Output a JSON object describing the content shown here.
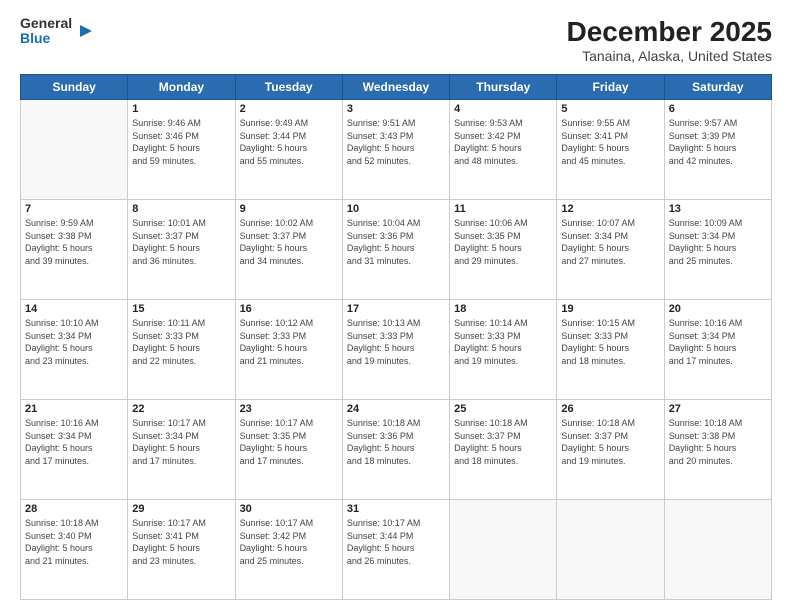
{
  "logo": {
    "line1": "General",
    "line2": "Blue"
  },
  "title": "December 2025",
  "subtitle": "Tanaina, Alaska, United States",
  "days_of_week": [
    "Sunday",
    "Monday",
    "Tuesday",
    "Wednesday",
    "Thursday",
    "Friday",
    "Saturday"
  ],
  "weeks": [
    [
      {
        "day": "",
        "info": ""
      },
      {
        "day": "1",
        "info": "Sunrise: 9:46 AM\nSunset: 3:46 PM\nDaylight: 5 hours\nand 59 minutes."
      },
      {
        "day": "2",
        "info": "Sunrise: 9:49 AM\nSunset: 3:44 PM\nDaylight: 5 hours\nand 55 minutes."
      },
      {
        "day": "3",
        "info": "Sunrise: 9:51 AM\nSunset: 3:43 PM\nDaylight: 5 hours\nand 52 minutes."
      },
      {
        "day": "4",
        "info": "Sunrise: 9:53 AM\nSunset: 3:42 PM\nDaylight: 5 hours\nand 48 minutes."
      },
      {
        "day": "5",
        "info": "Sunrise: 9:55 AM\nSunset: 3:41 PM\nDaylight: 5 hours\nand 45 minutes."
      },
      {
        "day": "6",
        "info": "Sunrise: 9:57 AM\nSunset: 3:39 PM\nDaylight: 5 hours\nand 42 minutes."
      }
    ],
    [
      {
        "day": "7",
        "info": "Sunrise: 9:59 AM\nSunset: 3:38 PM\nDaylight: 5 hours\nand 39 minutes."
      },
      {
        "day": "8",
        "info": "Sunrise: 10:01 AM\nSunset: 3:37 PM\nDaylight: 5 hours\nand 36 minutes."
      },
      {
        "day": "9",
        "info": "Sunrise: 10:02 AM\nSunset: 3:37 PM\nDaylight: 5 hours\nand 34 minutes."
      },
      {
        "day": "10",
        "info": "Sunrise: 10:04 AM\nSunset: 3:36 PM\nDaylight: 5 hours\nand 31 minutes."
      },
      {
        "day": "11",
        "info": "Sunrise: 10:06 AM\nSunset: 3:35 PM\nDaylight: 5 hours\nand 29 minutes."
      },
      {
        "day": "12",
        "info": "Sunrise: 10:07 AM\nSunset: 3:34 PM\nDaylight: 5 hours\nand 27 minutes."
      },
      {
        "day": "13",
        "info": "Sunrise: 10:09 AM\nSunset: 3:34 PM\nDaylight: 5 hours\nand 25 minutes."
      }
    ],
    [
      {
        "day": "14",
        "info": "Sunrise: 10:10 AM\nSunset: 3:34 PM\nDaylight: 5 hours\nand 23 minutes."
      },
      {
        "day": "15",
        "info": "Sunrise: 10:11 AM\nSunset: 3:33 PM\nDaylight: 5 hours\nand 22 minutes."
      },
      {
        "day": "16",
        "info": "Sunrise: 10:12 AM\nSunset: 3:33 PM\nDaylight: 5 hours\nand 21 minutes."
      },
      {
        "day": "17",
        "info": "Sunrise: 10:13 AM\nSunset: 3:33 PM\nDaylight: 5 hours\nand 19 minutes."
      },
      {
        "day": "18",
        "info": "Sunrise: 10:14 AM\nSunset: 3:33 PM\nDaylight: 5 hours\nand 19 minutes."
      },
      {
        "day": "19",
        "info": "Sunrise: 10:15 AM\nSunset: 3:33 PM\nDaylight: 5 hours\nand 18 minutes."
      },
      {
        "day": "20",
        "info": "Sunrise: 10:16 AM\nSunset: 3:34 PM\nDaylight: 5 hours\nand 17 minutes."
      }
    ],
    [
      {
        "day": "21",
        "info": "Sunrise: 10:16 AM\nSunset: 3:34 PM\nDaylight: 5 hours\nand 17 minutes."
      },
      {
        "day": "22",
        "info": "Sunrise: 10:17 AM\nSunset: 3:34 PM\nDaylight: 5 hours\nand 17 minutes."
      },
      {
        "day": "23",
        "info": "Sunrise: 10:17 AM\nSunset: 3:35 PM\nDaylight: 5 hours\nand 17 minutes."
      },
      {
        "day": "24",
        "info": "Sunrise: 10:18 AM\nSunset: 3:36 PM\nDaylight: 5 hours\nand 18 minutes."
      },
      {
        "day": "25",
        "info": "Sunrise: 10:18 AM\nSunset: 3:37 PM\nDaylight: 5 hours\nand 18 minutes."
      },
      {
        "day": "26",
        "info": "Sunrise: 10:18 AM\nSunset: 3:37 PM\nDaylight: 5 hours\nand 19 minutes."
      },
      {
        "day": "27",
        "info": "Sunrise: 10:18 AM\nSunset: 3:38 PM\nDaylight: 5 hours\nand 20 minutes."
      }
    ],
    [
      {
        "day": "28",
        "info": "Sunrise: 10:18 AM\nSunset: 3:40 PM\nDaylight: 5 hours\nand 21 minutes."
      },
      {
        "day": "29",
        "info": "Sunrise: 10:17 AM\nSunset: 3:41 PM\nDaylight: 5 hours\nand 23 minutes."
      },
      {
        "day": "30",
        "info": "Sunrise: 10:17 AM\nSunset: 3:42 PM\nDaylight: 5 hours\nand 25 minutes."
      },
      {
        "day": "31",
        "info": "Sunrise: 10:17 AM\nSunset: 3:44 PM\nDaylight: 5 hours\nand 26 minutes."
      },
      {
        "day": "",
        "info": ""
      },
      {
        "day": "",
        "info": ""
      },
      {
        "day": "",
        "info": ""
      }
    ]
  ]
}
